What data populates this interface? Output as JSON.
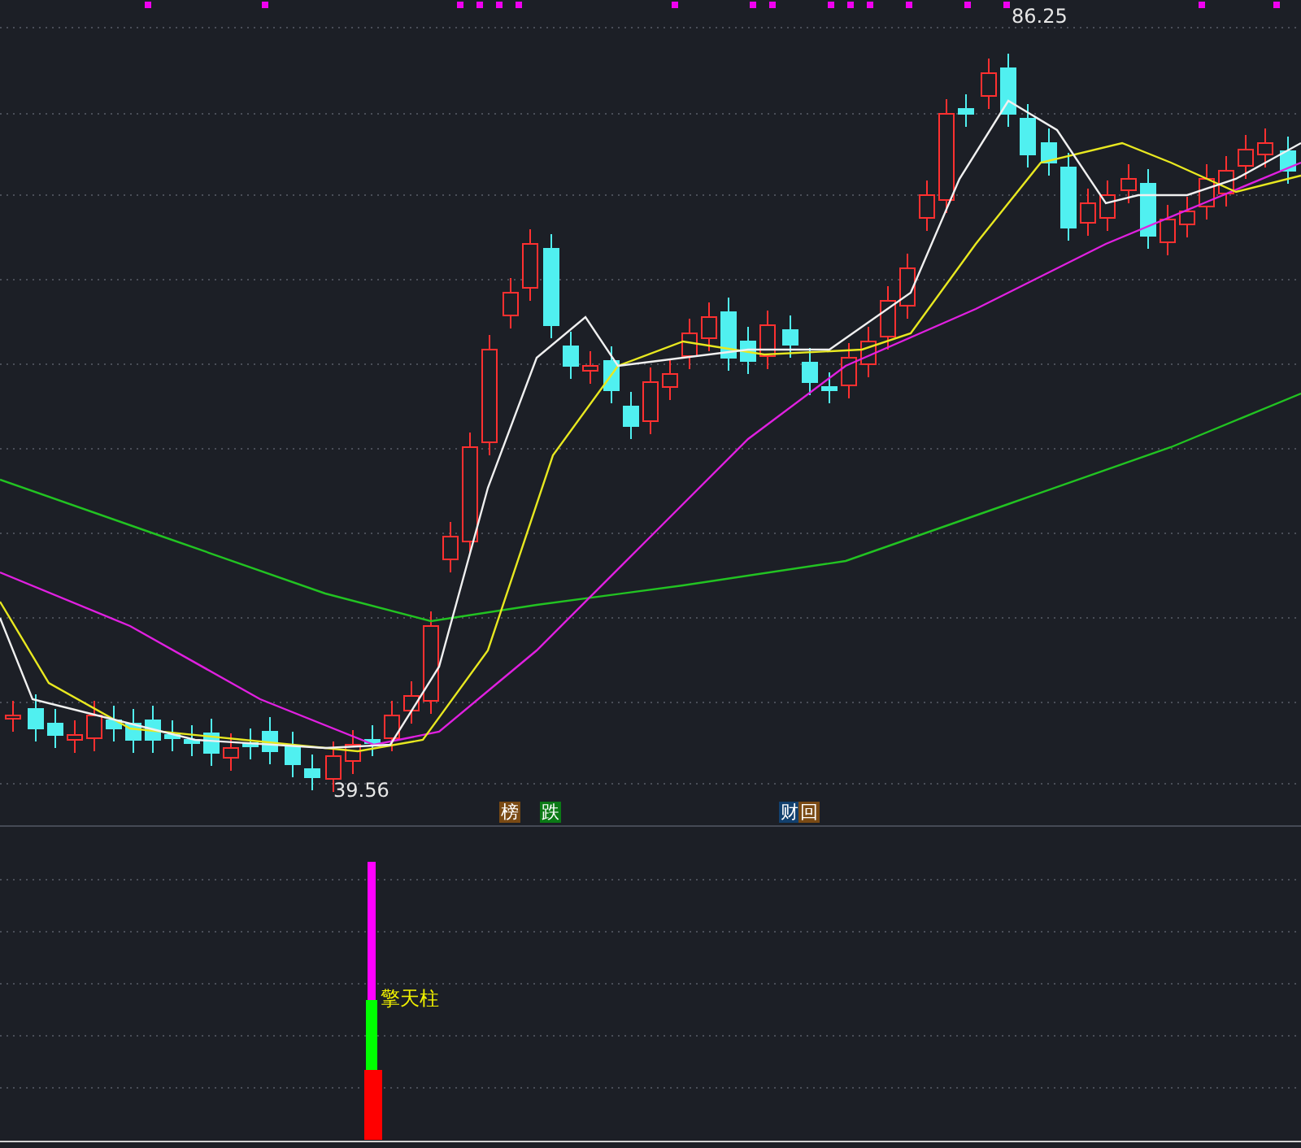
{
  "price_chart": {
    "high_label": "86.25",
    "low_label": "39.56"
  },
  "signals": [
    {
      "label": "榜",
      "color": "#7a4a14"
    },
    {
      "label": "跌",
      "color": "#0b7a16"
    },
    {
      "label": "财",
      "color": "#12406e"
    },
    {
      "label": "回",
      "color": "#7a4a14"
    }
  ],
  "indicator": {
    "label": "擎天柱"
  }
}
